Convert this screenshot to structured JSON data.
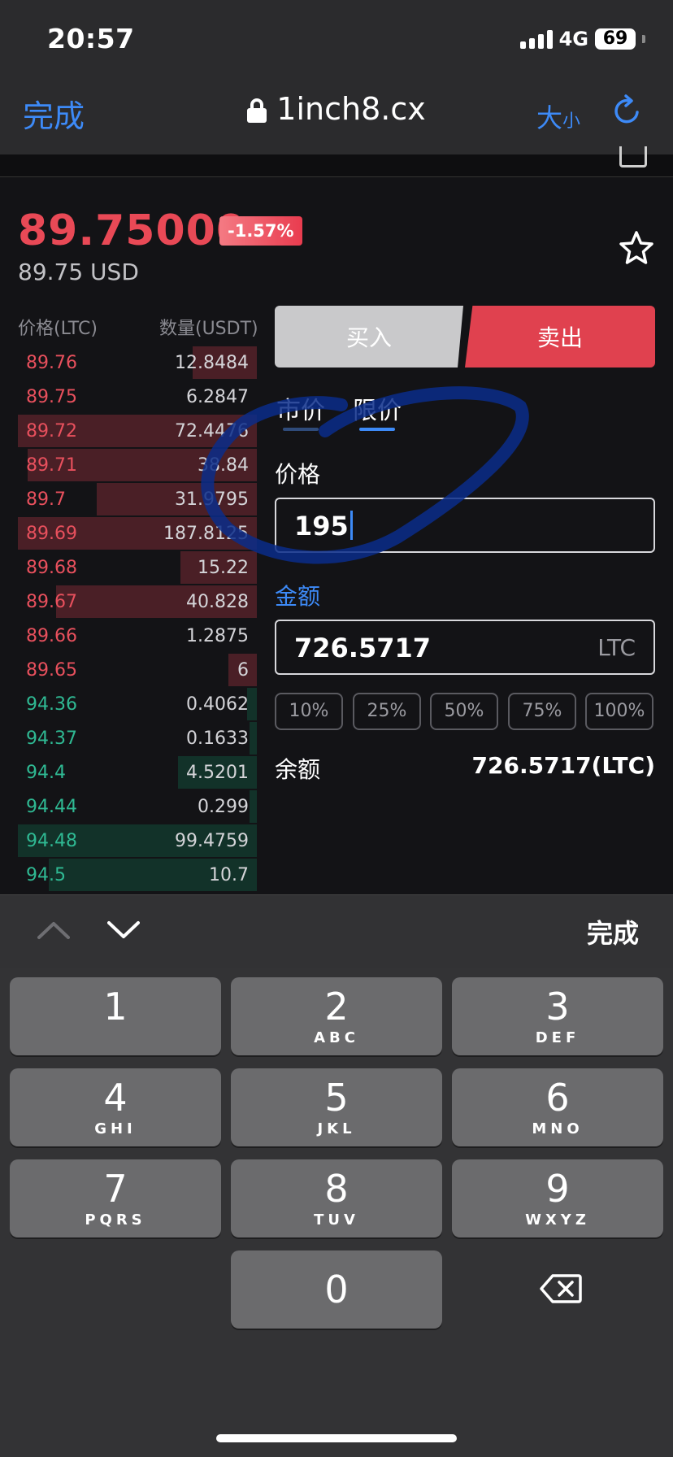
{
  "status_bar": {
    "time": "20:57",
    "network": "4G",
    "battery": "69"
  },
  "browser": {
    "done_label": "完成",
    "url": "1inch8.cx",
    "text_size_big": "大",
    "text_size_small": "小"
  },
  "ticker": {
    "price": "89.75000",
    "change": "-1.57%",
    "price_usd": "89.75 USD"
  },
  "order_book": {
    "col_price": "价格(LTC)",
    "col_qty": "数量(USDT)",
    "asks": [
      {
        "price": "89.76",
        "qty": "12.8484",
        "depth": 0.27
      },
      {
        "price": "89.75",
        "qty": "6.2847",
        "depth": 0
      },
      {
        "price": "89.72",
        "qty": "72.4476",
        "depth": 1.0
      },
      {
        "price": "89.71",
        "qty": "38.84",
        "depth": 0.96
      },
      {
        "price": "89.7",
        "qty": "31.9795",
        "depth": 0.67
      },
      {
        "price": "89.69",
        "qty": "187.8125",
        "depth": 1.0
      },
      {
        "price": "89.68",
        "qty": "15.22",
        "depth": 0.32
      },
      {
        "price": "89.67",
        "qty": "40.828",
        "depth": 0.84
      },
      {
        "price": "89.66",
        "qty": "1.2875",
        "depth": 0
      },
      {
        "price": "89.65",
        "qty": "6",
        "depth": 0.12
      }
    ],
    "bids": [
      {
        "price": "94.36",
        "qty": "0.4062",
        "depth": 0.04
      },
      {
        "price": "94.37",
        "qty": "0.1633",
        "depth": 0.03
      },
      {
        "price": "94.4",
        "qty": "4.5201",
        "depth": 0.33
      },
      {
        "price": "94.44",
        "qty": "0.299",
        "depth": 0.03
      },
      {
        "price": "94.48",
        "qty": "99.4759",
        "depth": 1.0
      },
      {
        "price": "94.5",
        "qty": "10.7",
        "depth": 0.87
      }
    ]
  },
  "trade": {
    "buy_label": "买入",
    "sell_label": "卖出",
    "market_label": "市价",
    "limit_label": "限价",
    "price_label": "价格",
    "price_value": "195",
    "amount_label": "金额",
    "amount_value": "726.5717",
    "amount_unit": "LTC",
    "percents": [
      "10%",
      "25%",
      "50%",
      "75%",
      "100%"
    ],
    "balance_label": "余额",
    "balance_value": "726.5717(LTC)"
  },
  "keyboard": {
    "done_label": "完成",
    "keys": [
      {
        "num": "1",
        "letters": ""
      },
      {
        "num": "2",
        "letters": "ABC"
      },
      {
        "num": "3",
        "letters": "DEF"
      },
      {
        "num": "4",
        "letters": "GHI"
      },
      {
        "num": "5",
        "letters": "JKL"
      },
      {
        "num": "6",
        "letters": "MNO"
      },
      {
        "num": "7",
        "letters": "PQRS"
      },
      {
        "num": "8",
        "letters": "TUV"
      },
      {
        "num": "9",
        "letters": "WXYZ"
      },
      {
        "num": "0",
        "letters": ""
      }
    ]
  },
  "colors": {
    "accent_blue": "#3d8af7",
    "ask_red": "#e8505d",
    "bid_green": "#2fb993",
    "sell_red": "#e0414f"
  }
}
